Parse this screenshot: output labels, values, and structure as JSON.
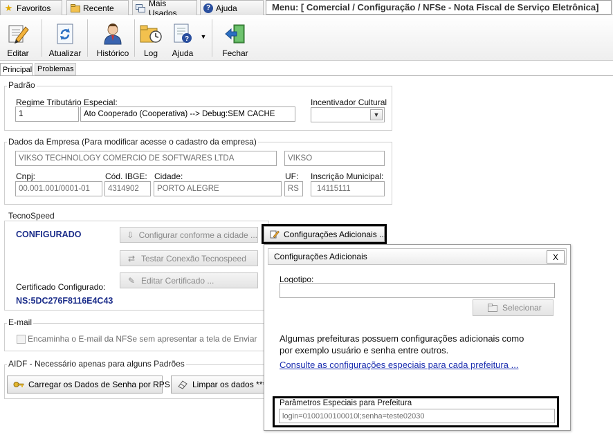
{
  "topbar": {
    "tabs": [
      {
        "label": "Favoritos",
        "icon": "star-icon"
      },
      {
        "label": "Recente",
        "icon": "folder-icon"
      },
      {
        "label": "Mais Usados",
        "icon": "screens-icon"
      },
      {
        "label": "Ajuda",
        "icon": "help-icon"
      }
    ],
    "menu_title": "Menu: [ Comercial / Configuração / NFSe - Nota Fiscal de Serviço Eletrônica]"
  },
  "toolbar": {
    "editar": "Editar",
    "atualizar": "Atualizar",
    "historico": "Histórico",
    "log": "Log",
    "ajuda": "Ajuda",
    "fechar": "Fechar"
  },
  "subtabs": {
    "principal": "Principal",
    "problemas": "Problemas"
  },
  "padrao": {
    "title": "Padrão",
    "regime_label": "Regime Tributário Especial:",
    "regime_code": "1",
    "regime_desc": "Ato Cooperado (Cooperativa)   --> Debug:SEM CACHE",
    "incentivador_label": "Incentivador Cultural",
    "incentivador_value": ""
  },
  "empresa": {
    "title": "Dados da Empresa (Para modificar acesse o cadastro da empresa)",
    "razao_social": "VIKSO TECHNOLOGY COMERCIO DE SOFTWARES LTDA",
    "fantasia": "VIKSO",
    "cnpj_label": "Cnpj:",
    "cnpj": "00.001.001/0001-01",
    "ibge_label": "Cód. IBGE:",
    "ibge": "4314902",
    "cidade_label": "Cidade:",
    "cidade": "PORTO ALEGRE",
    "uf_label": "UF:",
    "uf": "RS",
    "inscricao_label": "Inscrição Municipal:",
    "inscricao": "14115111"
  },
  "tecnospeed": {
    "title": "TecnoSpeed",
    "status": "CONFIGURADO",
    "configurar_cidade": "Configurar conforme a cidade ...",
    "configuracoes_adicionais": "Configurações Adicionais ...",
    "testar_conexao": "Testar Conexão Tecnospeed",
    "editar_certificado": "Editar Certificado ...",
    "certificado_label": "Certificado Configurado:",
    "certificado_ns": "NS:5DC276F8116E4C43"
  },
  "email": {
    "title": "E-mail",
    "checkbox_label": "Encaminha o E-mail da NFSe sem apresentar a tela de Enviar",
    "checked": false
  },
  "aidf": {
    "title": "AIDF - Necessário apenas para alguns Padrões",
    "carregar": "Carregar os Dados de Senha por RPS",
    "limpar": "Limpar os dados ***"
  },
  "popup": {
    "title": "Configurações Adicionais",
    "close": "X",
    "logotipo_label": "Logotipo:",
    "logotipo_value": "",
    "selecionar": "Selecionar",
    "info_line1": "Algumas prefeituras possuem configurações adicionais como",
    "info_line2": "por exemplo usuário e senha entre outros.",
    "link": "Consulte as configurações especiais para cada prefeitura ...",
    "params_label": "Parâmetros Especiais para Prefeitura",
    "params_value": "login=0100100100010l;senha=teste02030"
  },
  "colors": {
    "status_blue": "#1b2d8a",
    "link_blue": "#1c2fb0",
    "highlight_border": "#000000"
  }
}
